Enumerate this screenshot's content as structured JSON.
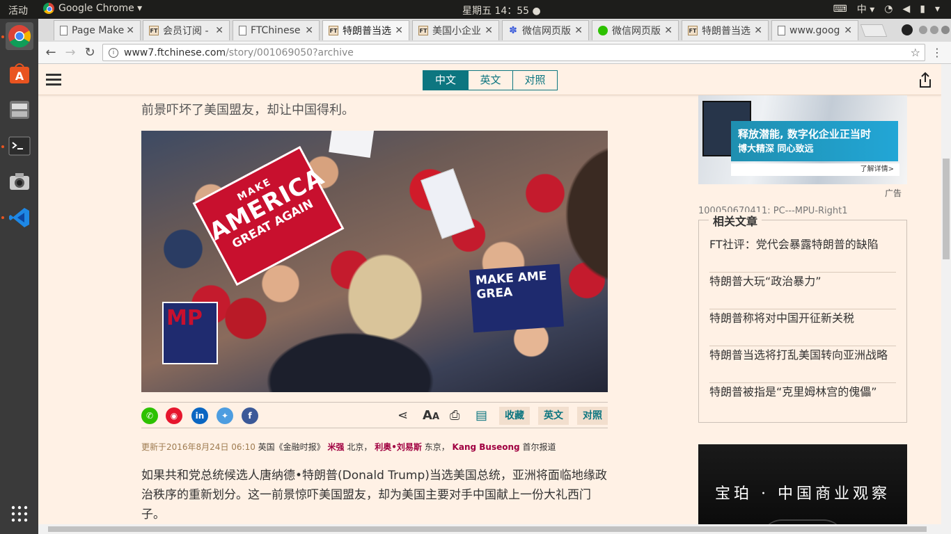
{
  "topbar": {
    "activities": "活动",
    "app_name": "Google Chrome ▾",
    "clock": "星期五 14：55 ●",
    "input_method": "中 ▾"
  },
  "tabs": [
    {
      "icon": "doc",
      "label": "Page Make"
    },
    {
      "icon": "ft",
      "label": "会员订阅 -"
    },
    {
      "icon": "doc",
      "label": "FTChinese"
    },
    {
      "icon": "ft",
      "label": "特朗普当选"
    },
    {
      "icon": "ft",
      "label": "美国小企业"
    },
    {
      "icon": "paw",
      "label": "微信网页版"
    },
    {
      "icon": "wechat",
      "label": "微信网页版"
    },
    {
      "icon": "ft",
      "label": "特朗普当选"
    },
    {
      "icon": "doc",
      "label": "www.goog"
    }
  ],
  "omnibox": {
    "host": "www7.ftchinese.com",
    "path": "/story/001069050?archive"
  },
  "ft": {
    "lang": [
      "中文",
      "英文",
      "对照"
    ],
    "lead": "前景吓坏了美国盟友，却让中国得利。",
    "photo": {
      "sign_make": "MAKE",
      "sign_america": "AMERICA",
      "sign_great": "GREAT AGAIN",
      "blue_sign": "MAKE AME GREA",
      "blue_sign2": "MP"
    },
    "share_buttons": {
      "fav": "收藏",
      "english": "英文",
      "bilingual": "对照"
    },
    "byline": {
      "updated": "更新于2016年8月24日 06:10",
      "source": "英国《金融时报》",
      "author1": "米强",
      "loc1": "北京，",
      "author2": "利奥•刘易斯",
      "loc2": "东京，",
      "author3": "Kang Buseong",
      "loc3": "首尔报道"
    },
    "body": "如果共和党总统候选人唐纳德•特朗普(Donald Trump)当选美国总统，亚洲将面临地缘政治秩序的重新划分。这一前景惊吓美国盟友，却为美国主要对手中国献上一份大礼西门子。",
    "ad_top": {
      "headline": "释放潜能, 数字化企业正当时",
      "sub": "博大精深 同心致远",
      "cta": "了解详情>"
    },
    "ad_label": "广告",
    "ad_slot": "100050670411: PC---MPU-Right1",
    "related": {
      "title": "相关文章",
      "items": [
        "FT社评：党代会暴露特朗普的缺陷",
        "特朗普大玩“政治暴力”",
        "特朗普称将对中国开征新关税",
        "特朗普当选将打乱美国转向亚洲战略",
        "特朗普被指是“克里姆林宫的傀儡”"
      ]
    },
    "ad_bottom": "宝珀 · 中国商业观察"
  }
}
